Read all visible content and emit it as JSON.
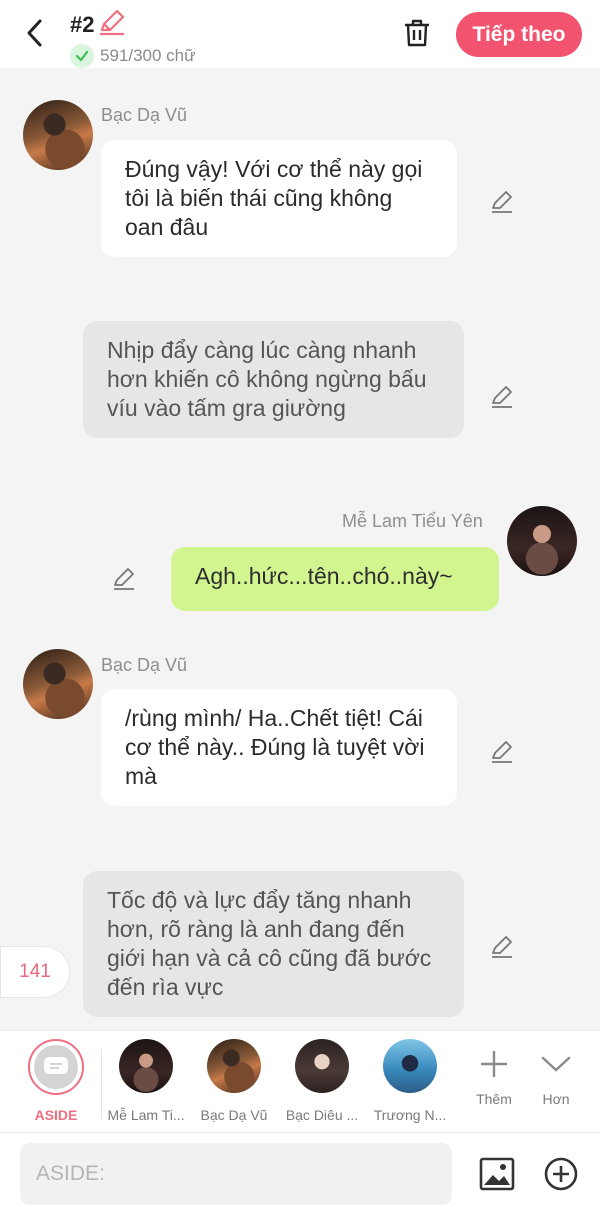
{
  "header": {
    "title": "#2",
    "word_count": "591/300 chữ",
    "next_label": "Tiếp theo"
  },
  "messages": [
    {
      "sender": "Bạc Dạ Vũ",
      "text": "Đúng vậy! Với cơ thể này gọi tôi là biến thái cũng không oan đâu"
    },
    {
      "text": "Nhịp đẩy càng lúc càng nhanh hơn khiến cô không ngừng bấu víu vào tấm gra giường"
    },
    {
      "sender": "Mễ Lam Tiểu Yên",
      "text": "Agh..hức...tên..chó..này~"
    },
    {
      "sender": "Bạc Dạ Vũ",
      "text": "/rùng mình/ Ha..Chết tiệt! Cái cơ thể này.. Đúng là tuyệt vời mà"
    },
    {
      "text": "Tốc độ và lực đẩy tăng nhanh hơn, rõ ràng là anh đang đến giới hạn và cả cô cũng đã bước đến rìa vực"
    }
  ],
  "counter": "141",
  "characters": [
    {
      "name": "ASIDE"
    },
    {
      "name": "Mễ Lam Ti..."
    },
    {
      "name": "Bạc Dạ Vũ"
    },
    {
      "name": "Bạc Diêu ..."
    },
    {
      "name": "Trương N..."
    }
  ],
  "controls": {
    "add_label": "Thêm",
    "more_label": "Hơn"
  },
  "input": {
    "placeholder": "ASIDE:"
  },
  "colors": {
    "accent": "#f2546f",
    "user_bubble": "#d2f590",
    "narration_bubble": "#e6e6e6"
  }
}
